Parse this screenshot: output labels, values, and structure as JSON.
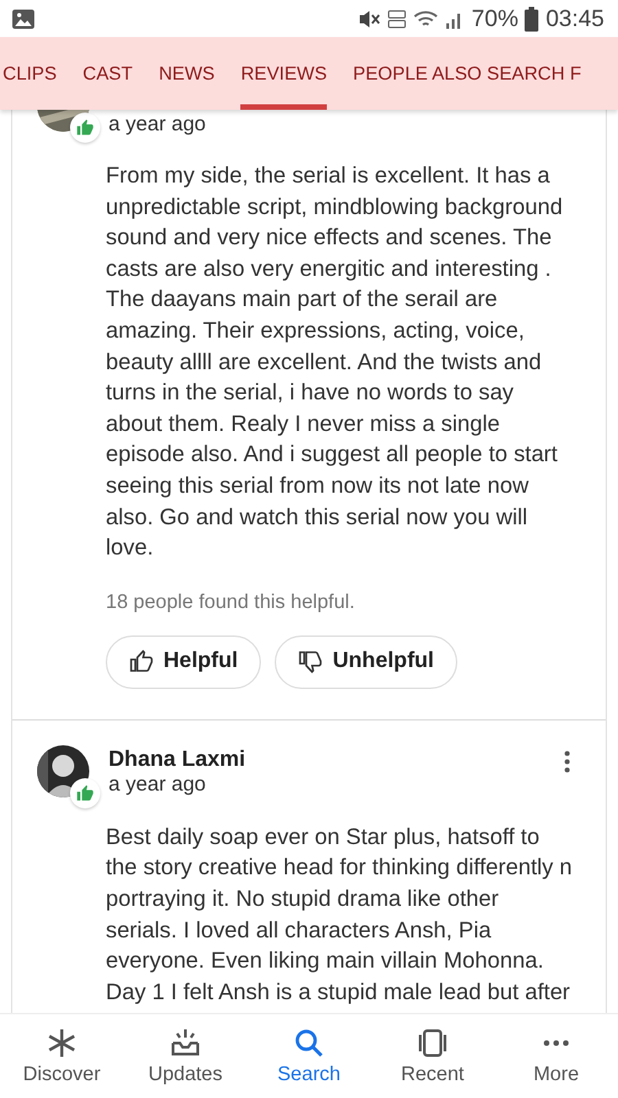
{
  "status_bar": {
    "battery": "70%",
    "time": "03:45"
  },
  "tabs": [
    {
      "label": "CLIPS",
      "selected": false
    },
    {
      "label": "CAST",
      "selected": false
    },
    {
      "label": "NEWS",
      "selected": false
    },
    {
      "label": "REVIEWS",
      "selected": true
    },
    {
      "label": "PEOPLE ALSO SEARCH F",
      "selected": false
    }
  ],
  "reviews": [
    {
      "time": "a year ago",
      "liked": true,
      "text": "From my side, the serial is excellent. It has a unpredictable script, mindblowing background sound and very nice effects and scenes. The casts are also very energitic and interesting . The daayans main part of the serail are amazing. Their expressions, acting, voice, beauty allll are excellent. And the twists and turns in the serial, i have no words to say about them. Realy I never miss a single episode also. And i suggest all people to start seeing this serial from now its not late now also. Go and watch this serial now you will love.",
      "helpful_count": "18 people found this helpful.",
      "buttons": [
        "Helpful",
        "Unhelpful"
      ]
    },
    {
      "author": "Dhana Laxmi",
      "time": "a year ago",
      "liked": true,
      "text": "Best daily soap ever on Star plus, hatsoff to the story creative head for thinking differently n portraying it. No stupid drama like other serials. I loved all characters Ansh, Pia everyone. Even liking main villain Mohonna. Day 1 I felt Ansh is a stupid male lead but after"
    }
  ],
  "bottom_nav": [
    {
      "label": "Discover",
      "selected": false
    },
    {
      "label": "Updates",
      "selected": false
    },
    {
      "label": "Search",
      "selected": true
    },
    {
      "label": "Recent",
      "selected": false
    },
    {
      "label": "More",
      "selected": false
    }
  ]
}
